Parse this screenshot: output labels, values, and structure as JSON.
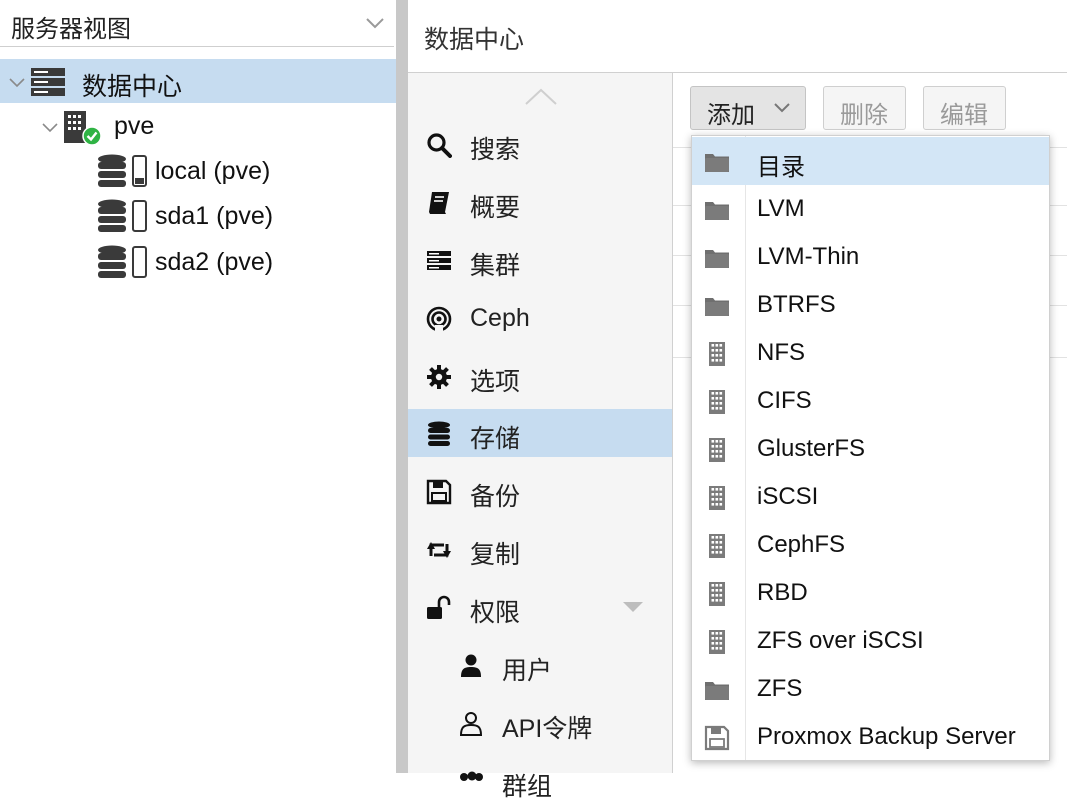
{
  "view_selector": {
    "label": "服务器视图"
  },
  "tree": {
    "datacenter": "数据中心",
    "node": "pve",
    "storages": [
      "local (pve)",
      "sda1 (pve)",
      "sda2 (pve)"
    ]
  },
  "header": {
    "title": "数据中心"
  },
  "nav": {
    "items": [
      "搜索",
      "概要",
      "集群",
      "Ceph",
      "选项",
      "存储",
      "备份",
      "复制",
      "权限"
    ],
    "sub_items": [
      "用户",
      "API令牌",
      "群组"
    ],
    "selected": "存储"
  },
  "toolbar": {
    "add_label": "添加",
    "delete_label": "删除",
    "edit_label": "编辑"
  },
  "add_menu": {
    "items": [
      {
        "label": "目录",
        "icon": "folder-icon"
      },
      {
        "label": "LVM",
        "icon": "folder-icon"
      },
      {
        "label": "LVM-Thin",
        "icon": "folder-icon"
      },
      {
        "label": "BTRFS",
        "icon": "folder-icon"
      },
      {
        "label": "NFS",
        "icon": "building-icon"
      },
      {
        "label": "CIFS",
        "icon": "building-icon"
      },
      {
        "label": "GlusterFS",
        "icon": "building-icon"
      },
      {
        "label": "iSCSI",
        "icon": "building-icon"
      },
      {
        "label": "CephFS",
        "icon": "building-icon"
      },
      {
        "label": "RBD",
        "icon": "building-icon"
      },
      {
        "label": "ZFS over iSCSI",
        "icon": "building-icon"
      },
      {
        "label": "ZFS",
        "icon": "folder-icon"
      },
      {
        "label": "Proxmox Backup Server",
        "icon": "floppy-icon"
      }
    ]
  },
  "colors": {
    "selection": "#c6dcf0",
    "menu_highlight": "#d3e6f6",
    "status_ok": "#2fb344"
  }
}
